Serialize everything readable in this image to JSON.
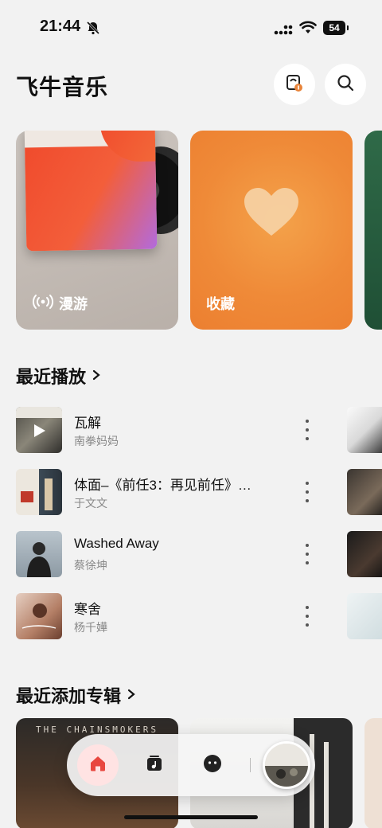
{
  "status": {
    "time": "21:44",
    "battery": "54"
  },
  "header": {
    "title": "飞牛音乐"
  },
  "cards": [
    {
      "label": "漫游",
      "icon": "radio-waves-icon"
    },
    {
      "label": "收藏",
      "icon": "heart-icon"
    }
  ],
  "recent": {
    "title": "最近播放",
    "songs": [
      {
        "title": "瓦解",
        "artist": "南拳妈妈"
      },
      {
        "title": "体面–《前任3：再见前任》…",
        "artist": "于文文"
      },
      {
        "title": "Washed Away",
        "artist": "蔡徐坤"
      },
      {
        "title": "寒舍",
        "artist": "杨千嬅"
      }
    ]
  },
  "albums": {
    "title": "最近添加专辑",
    "items": [
      {
        "band": "THE CHAINSMOKERS"
      }
    ]
  },
  "colors": {
    "accent": "#e8473f",
    "card_orange": "#ef8a38",
    "background": "#f2f2f2"
  }
}
